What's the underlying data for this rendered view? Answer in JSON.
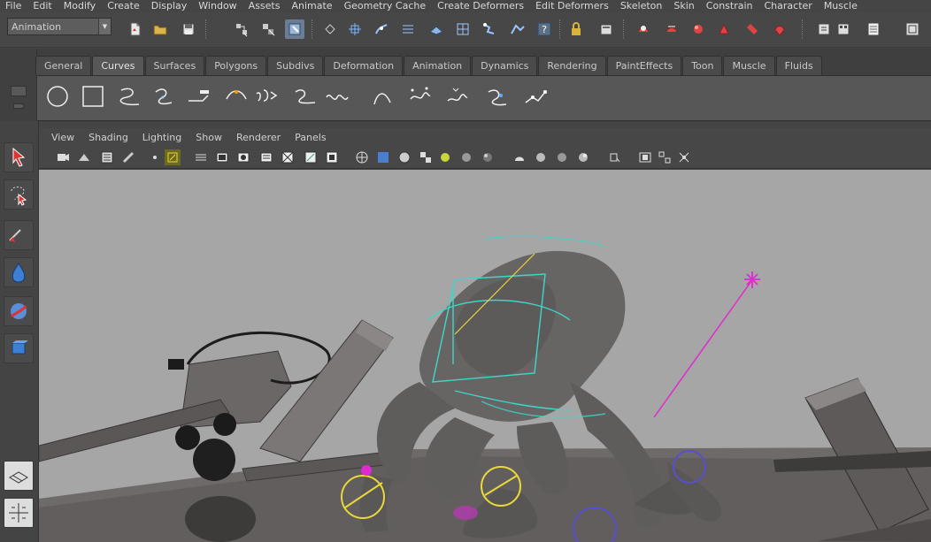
{
  "menubar": {
    "items": [
      "File",
      "Edit",
      "Modify",
      "Create",
      "Display",
      "Window",
      "Assets",
      "Animate",
      "Geometry Cache",
      "Create Deformers",
      "Edit Deformers",
      "Skeleton",
      "Skin",
      "Constrain",
      "Character",
      "Muscle"
    ]
  },
  "statusline": {
    "mode_menu": {
      "selected": "Animation"
    },
    "icons": [
      "new-scene-icon",
      "open-scene-icon",
      "save-scene-icon",
      "select-hierarchy-icon",
      "select-object-icon",
      "select-component-icon",
      "lock-selection-icon",
      "snap-grid-icon",
      "snap-curve-icon",
      "snap-point-icon",
      "snap-view-plane-icon",
      "snap-live-icon",
      "history-icon",
      "help-icon",
      "lock-icon",
      "construction-history-icon",
      "render-frame-icon",
      "ipr-render-icon",
      "render-settings-icon",
      "hypershade-icon",
      "sculpt-icon",
      "paint-icon",
      "show-hide-channel-box-icon",
      "attribute-editor-icon",
      "tool-settings-icon"
    ]
  },
  "shelf": {
    "tabs": [
      "General",
      "Curves",
      "Surfaces",
      "Polygons",
      "Subdivs",
      "Deformation",
      "Animation",
      "Dynamics",
      "Rendering",
      "PaintEffects",
      "Toon",
      "Muscle",
      "Fluids"
    ],
    "active_tab": "Curves",
    "icons": [
      "nurbs-circle-icon",
      "nurbs-square-icon",
      "cv-curve-icon",
      "ep-curve-icon",
      "pencil-curve-icon",
      "arc-tool-icon",
      "text-curve-icon",
      "attach-curves-icon",
      "detach-curves-icon",
      "insert-knot-icon",
      "extend-curve-icon",
      "offset-curve-icon",
      "rebuild-curve-icon",
      "reverse-curve-icon"
    ]
  },
  "toolbox": {
    "tools": [
      "select-tool-icon",
      "lasso-tool-icon",
      "paint-select-icon",
      "soft-mod-icon",
      "move-tool-icon",
      "rotate-tool-icon"
    ],
    "layout_icons": [
      "single-perspective-layout-icon",
      "four-view-layout-icon"
    ]
  },
  "panel": {
    "menu": [
      "View",
      "Shading",
      "Lighting",
      "Show",
      "Renderer",
      "Panels"
    ]
  },
  "colors": {
    "menubar_bg": "#454545",
    "toolbar_bg": "#474747",
    "shelf_bg": "#575757",
    "viewport_bg": "#a7a6a6",
    "selection_cyan": "#3fd6c9",
    "control_yellow": "#e8d83a",
    "ik_magenta": "#e02ad1"
  }
}
